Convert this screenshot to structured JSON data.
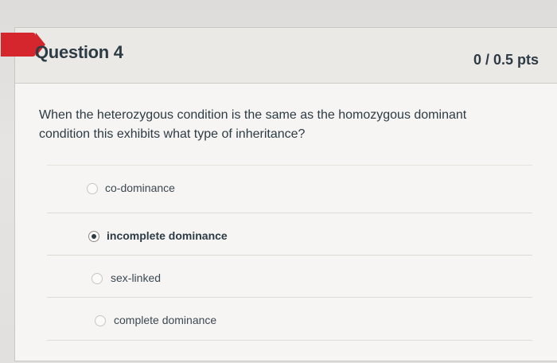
{
  "question": {
    "title": "Question 4",
    "points": "0 / 0.5 pts",
    "text": "When the heterozygous condition is the same as the homozygous dominant condition this exhibits what type of inheritance?",
    "flag_color": "#d4262c"
  },
  "answers": [
    {
      "label": "co-dominance",
      "selected": false
    },
    {
      "label": "incomplete dominance",
      "selected": true
    },
    {
      "label": "sex-linked",
      "selected": false
    },
    {
      "label": "complete dominance",
      "selected": false
    }
  ]
}
